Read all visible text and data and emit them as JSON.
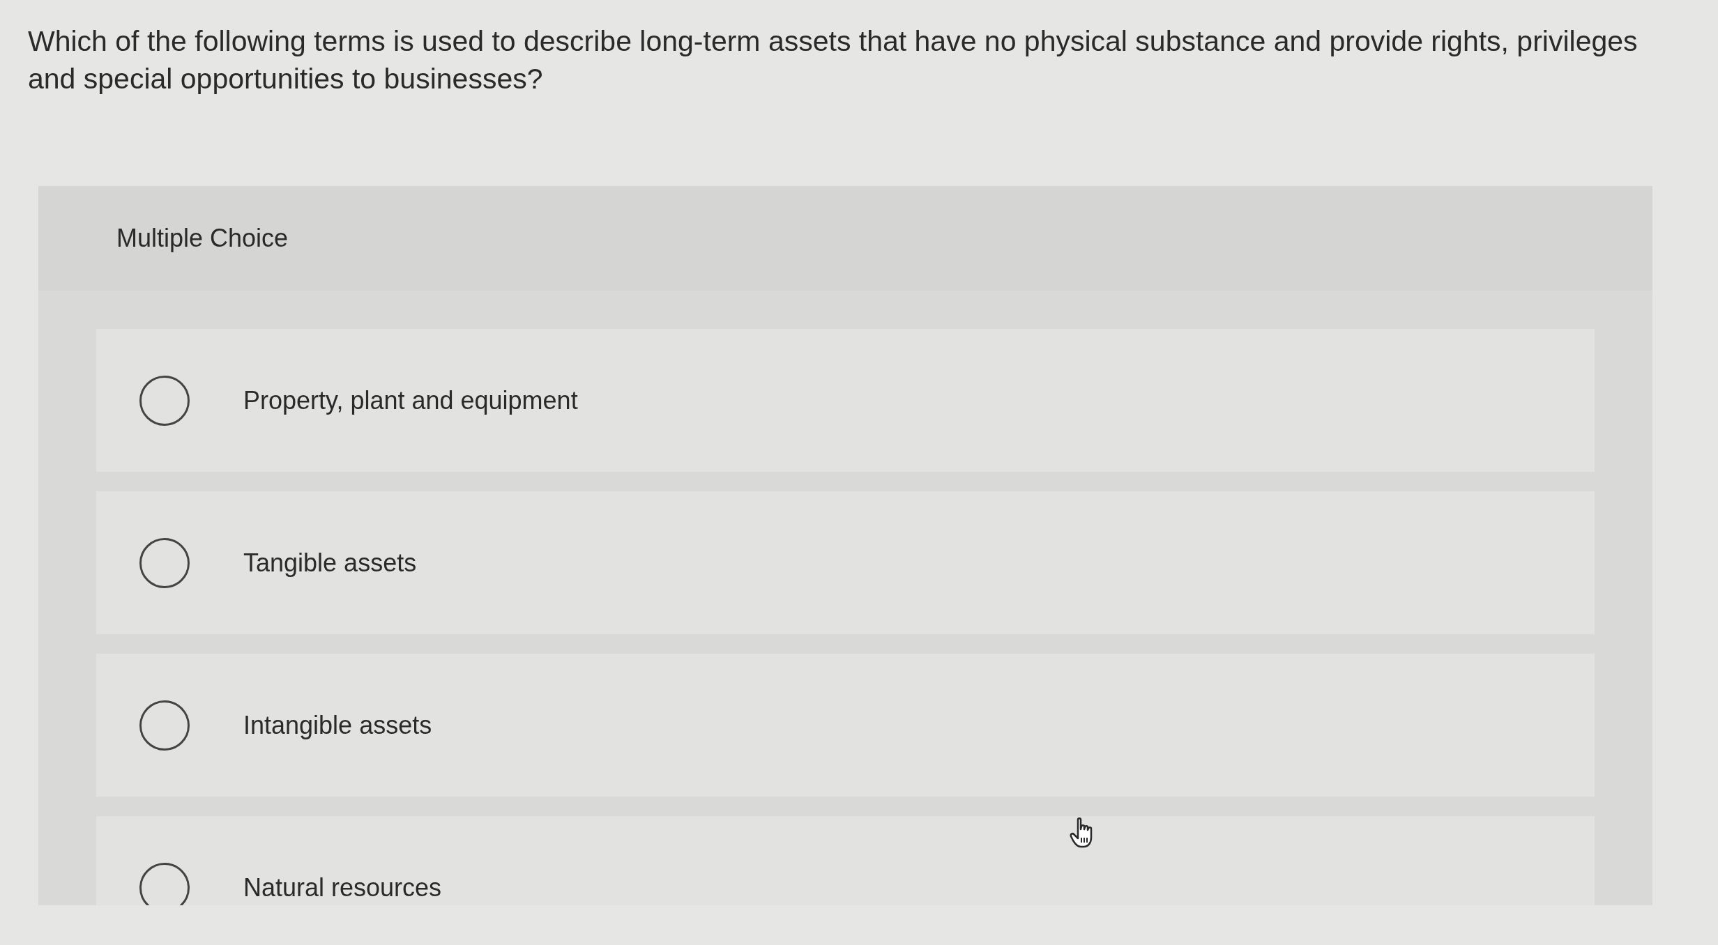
{
  "question": {
    "text": "Which of the following terms is used to describe long-term assets that have no physical substance and provide rights, privileges and special opportunities to businesses?"
  },
  "answer_panel": {
    "heading": "Multiple Choice",
    "options": [
      {
        "label": "Property, plant and equipment",
        "selected": false
      },
      {
        "label": "Tangible assets",
        "selected": false
      },
      {
        "label": "Intangible assets",
        "selected": false
      },
      {
        "label": "Natural resources",
        "selected": false
      }
    ]
  }
}
